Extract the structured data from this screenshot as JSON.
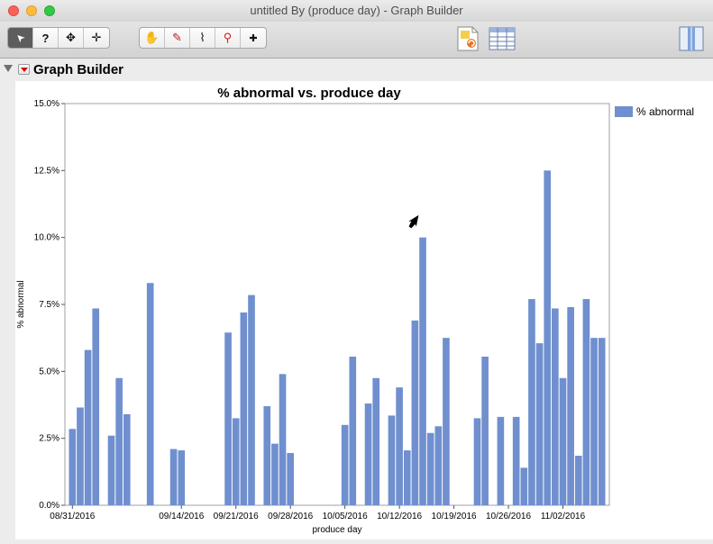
{
  "window": {
    "title": "untitled By (produce day) - Graph Builder"
  },
  "toolbar": {
    "tools": [
      {
        "name": "arrow-tool",
        "glyph": "➤",
        "active": true
      },
      {
        "name": "help-tool",
        "glyph": "?",
        "active": false
      },
      {
        "name": "selection-tool",
        "glyph": "✥",
        "active": false
      },
      {
        "name": "move-tool",
        "glyph": "✛",
        "active": false
      }
    ],
    "tools2": [
      {
        "name": "grabber-tool",
        "glyph": "✋"
      },
      {
        "name": "brush-tool",
        "glyph": "✎"
      },
      {
        "name": "lasso-tool",
        "glyph": "⌇"
      },
      {
        "name": "magnifier-tool",
        "glyph": "⚲"
      },
      {
        "name": "crosshair-tool",
        "glyph": "✚"
      }
    ]
  },
  "report": {
    "title": "Graph Builder"
  },
  "colors": {
    "bar": "#6f8fcf",
    "frame": "#9a9a9a"
  },
  "chart_data": {
    "type": "bar",
    "title": "% abnormal vs. produce day",
    "xlabel": "produce day",
    "ylabel": "% abnormal",
    "ylim": [
      0,
      15
    ],
    "yticks": [
      "0.0%",
      "2.5%",
      "5.0%",
      "7.5%",
      "10.0%",
      "12.5%",
      "15.0%"
    ],
    "x_ticks": [
      "08/31/2016",
      "09/14/2016",
      "09/21/2016",
      "09/28/2016",
      "10/05/2016",
      "10/12/2016",
      "10/19/2016",
      "10/26/2016",
      "11/02/2016"
    ],
    "legend": {
      "position": "right",
      "label": "% abnormal"
    },
    "series": [
      {
        "name": "% abnormal",
        "x": [
          "08/31/2016",
          "09/01/2016",
          "09/02/2016",
          "09/03/2016",
          "09/05/2016",
          "09/06/2016",
          "09/07/2016",
          "09/10/2016",
          "09/13/2016",
          "09/14/2016",
          "09/20/2016",
          "09/21/2016",
          "09/22/2016",
          "09/23/2016",
          "09/25/2016",
          "09/26/2016",
          "09/27/2016",
          "09/28/2016",
          "10/05/2016",
          "10/06/2016",
          "10/08/2016",
          "10/09/2016",
          "10/11/2016",
          "10/12/2016",
          "10/13/2016",
          "10/14/2016",
          "10/15/2016",
          "10/16/2016",
          "10/17/2016",
          "10/18/2016",
          "10/22/2016",
          "10/23/2016",
          "10/25/2016",
          "10/27/2016",
          "10/28/2016",
          "10/29/2016",
          "10/30/2016",
          "10/31/2016",
          "11/01/2016",
          "11/02/2016",
          "11/03/2016",
          "11/04/2016",
          "11/05/2016",
          "11/06/2016",
          "11/07/2016"
        ],
        "values": [
          2.85,
          3.65,
          5.8,
          7.35,
          2.6,
          4.75,
          3.4,
          8.3,
          2.1,
          2.05,
          6.45,
          3.25,
          7.2,
          7.85,
          3.7,
          2.3,
          4.9,
          1.95,
          3.0,
          5.55,
          3.8,
          4.75,
          3.35,
          4.4,
          2.05,
          6.9,
          10.0,
          2.7,
          2.95,
          6.25,
          3.25,
          5.55,
          3.3,
          3.3,
          1.4,
          7.7,
          6.05,
          12.5,
          7.35,
          4.75,
          7.4,
          1.85,
          7.7,
          6.25,
          6.25
        ]
      }
    ]
  }
}
